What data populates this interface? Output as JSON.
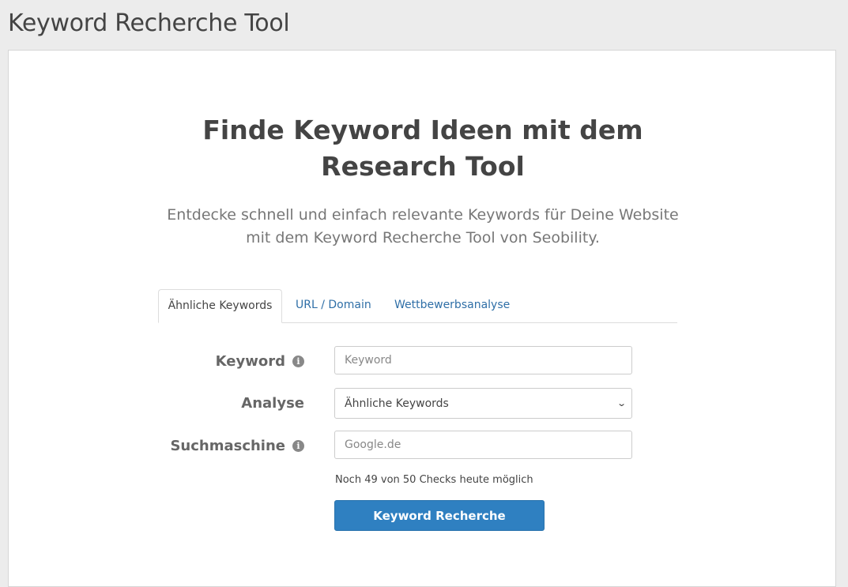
{
  "header": {
    "title": "Keyword Recherche Tool"
  },
  "hero": {
    "headline_line1": "Finde Keyword Ideen mit dem",
    "headline_line2": "Research Tool",
    "subline_line1": "Entdecke schnell und einfach relevante Keywords für Deine Website",
    "subline_line2": "mit dem Keyword Recherche Tool von Seobility."
  },
  "tabs": [
    {
      "label": "Ähnliche Keywords",
      "active": true
    },
    {
      "label": "URL / Domain",
      "active": false
    },
    {
      "label": "Wettbewerbsanalyse",
      "active": false
    }
  ],
  "form": {
    "keyword": {
      "label": "Keyword",
      "placeholder": "Keyword",
      "value": ""
    },
    "analyse": {
      "label": "Analyse",
      "selected": "Ähnliche Keywords"
    },
    "suchmaschine": {
      "label": "Suchmaschine",
      "placeholder": "Google.de",
      "value": ""
    },
    "checks_note": "Noch 49 von 50 Checks heute möglich",
    "submit_label": "Keyword Recherche"
  },
  "icons": {
    "info": "info-icon",
    "select_arrow": "chevron-down-icon"
  },
  "colors": {
    "accent": "#2f80c1",
    "link": "#2f6fa7",
    "page_bg": "#ececec"
  }
}
